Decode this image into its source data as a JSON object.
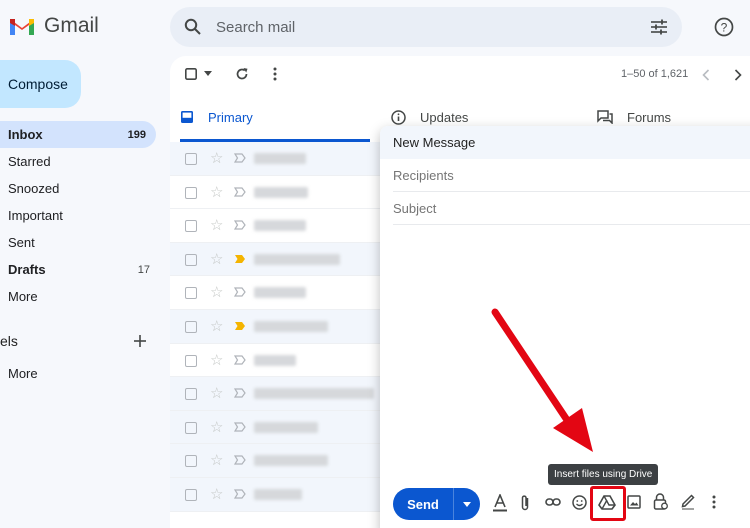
{
  "app": {
    "name": "Gmail"
  },
  "search": {
    "placeholder": "Search mail"
  },
  "compose_label": "Compose",
  "nav": [
    {
      "label": "Inbox",
      "count": "199",
      "active": true
    },
    {
      "label": "Starred",
      "count": ""
    },
    {
      "label": "Snoozed",
      "count": ""
    },
    {
      "label": "Important",
      "count": ""
    },
    {
      "label": "Sent",
      "count": ""
    },
    {
      "label": "Drafts",
      "count": "17",
      "bold": true
    },
    {
      "label": "More",
      "count": ""
    }
  ],
  "labels": {
    "title": "els",
    "more": "More"
  },
  "pager": "1–50 of 1,621",
  "tabs": {
    "primary": "Primary",
    "updates": "Updates",
    "forums": "Forums"
  },
  "rows": [
    {
      "important": false,
      "read": true
    },
    {
      "important": false,
      "read": false
    },
    {
      "important": false,
      "read": false
    },
    {
      "important": true,
      "read": true
    },
    {
      "important": false,
      "read": false
    },
    {
      "important": true,
      "read": true
    },
    {
      "important": false,
      "read": false
    },
    {
      "important": false,
      "read": true
    },
    {
      "important": false,
      "read": true
    },
    {
      "important": false,
      "read": true
    },
    {
      "important": false,
      "read": true
    }
  ],
  "compose_window": {
    "title": "New Message",
    "recipients_placeholder": "Recipients",
    "subject_placeholder": "Subject",
    "send_label": "Send"
  },
  "tooltip": "Insert files using Drive",
  "colors": {
    "accent": "#0b57d0",
    "highlight": "#e30613",
    "important": "#f4b400"
  }
}
